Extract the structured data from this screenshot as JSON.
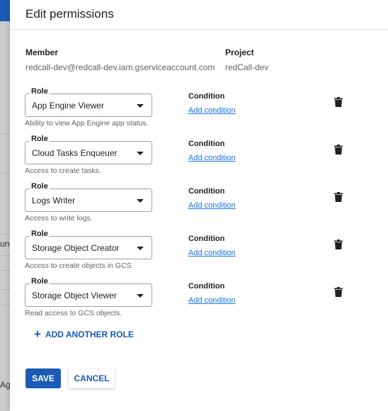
{
  "background": {
    "frag_1": "unt",
    "frag_2": "Ag"
  },
  "dialog": {
    "title": "Edit permissions",
    "member_label": "Member",
    "member_value": "redcall-dev@redcall-dev.iam.gserviceaccount.com",
    "project_label": "Project",
    "project_value": "redCall-dev"
  },
  "roles": [
    {
      "legend": "Role",
      "value": "App Engine Viewer",
      "description": "Ability to view App Engine app status.",
      "condition_label": "Condition",
      "condition_link": "Add condition"
    },
    {
      "legend": "Role",
      "value": "Cloud Tasks Enqueuer",
      "description": "Access to create tasks.",
      "condition_label": "Condition",
      "condition_link": "Add condition"
    },
    {
      "legend": "Role",
      "value": "Logs Writer",
      "description": "Access to write logs.",
      "condition_label": "Condition",
      "condition_link": "Add condition"
    },
    {
      "legend": "Role",
      "value": "Storage Object Creator",
      "description": "Access to create objects in GCS.",
      "condition_label": "Condition",
      "condition_link": "Add condition"
    },
    {
      "legend": "Role",
      "value": "Storage Object Viewer",
      "description": "Read access to GCS objects.",
      "condition_label": "Condition",
      "condition_link": "Add condition"
    }
  ],
  "actions": {
    "add_role_label": "ADD ANOTHER ROLE",
    "save_label": "SAVE",
    "cancel_label": "CANCEL"
  },
  "icons": {
    "trash": "trash-icon",
    "plus": "plus-icon",
    "caret": "chevron-down-icon"
  },
  "colors": {
    "primary": "#1a5bb5",
    "link": "#1a73e8",
    "text": "#202124",
    "muted": "#5f6368"
  }
}
